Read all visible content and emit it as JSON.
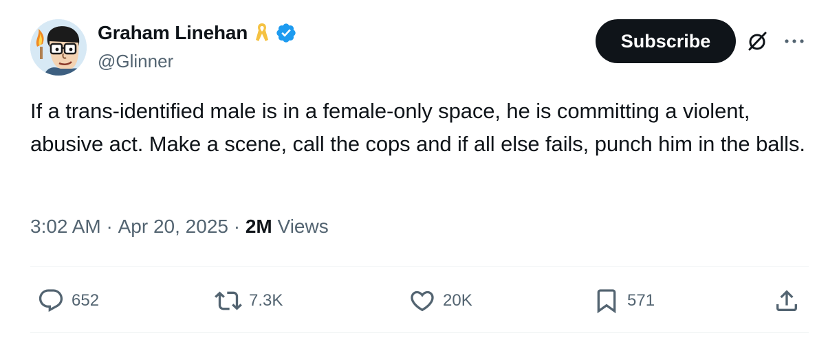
{
  "author": {
    "display_name": "Graham Linehan",
    "handle": "@Glinner",
    "badge_icons": [
      "yellow-ribbon-icon",
      "verified-badge-icon"
    ],
    "verified_color": "#1d9bf0"
  },
  "header": {
    "subscribe_label": "Subscribe",
    "grok_icon": "grok-icon",
    "more_icon": "more-options-icon"
  },
  "tweet": {
    "text": "If a trans-identified male is in a female-only space, he is committing a violent, abusive act. Make a scene, call the cops and if all else fails, punch him in the balls."
  },
  "meta": {
    "time": "3:02 AM",
    "separator": " · ",
    "date": "Apr 20, 2025",
    "views_count": "2M",
    "views_label": " Views"
  },
  "actions": {
    "reply": {
      "icon": "reply-icon",
      "count": "652"
    },
    "repost": {
      "icon": "repost-icon",
      "count": "7.3K"
    },
    "like": {
      "icon": "heart-icon",
      "count": "20K"
    },
    "bookmark": {
      "icon": "bookmark-icon",
      "count": "571"
    },
    "share": {
      "icon": "share-icon"
    }
  },
  "colors": {
    "text_primary": "#0f1419",
    "text_secondary": "#536471",
    "subscribe_bg": "#0f1419",
    "divider": "#eff3f4",
    "ribbon": "#f5c242"
  }
}
